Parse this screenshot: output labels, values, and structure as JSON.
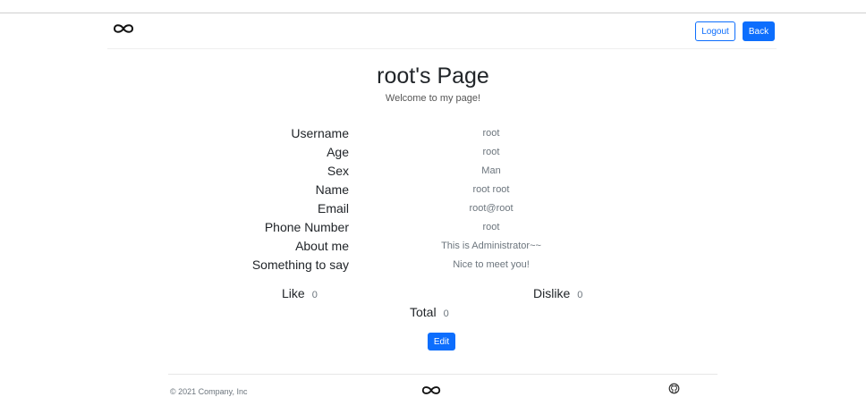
{
  "header": {
    "logo_icon": "infinity-icon",
    "logout_label": "Logout",
    "back_label": "Back"
  },
  "page": {
    "title": "root's Page",
    "subtitle": "Welcome to my page!"
  },
  "profile": [
    {
      "label": "Username",
      "value": "root"
    },
    {
      "label": "Age",
      "value": "root"
    },
    {
      "label": "Sex",
      "value": "Man"
    },
    {
      "label": "Name",
      "value": "root root"
    },
    {
      "label": "Email",
      "value": "root@root"
    },
    {
      "label": "Phone Number",
      "value": "root"
    },
    {
      "label": "About me",
      "value": "This is Administrator~~"
    },
    {
      "label": "Something to say",
      "value": "Nice to meet you!"
    }
  ],
  "stats": {
    "like_label": "Like",
    "like_value": "0",
    "dislike_label": "Dislike",
    "dislike_value": "0",
    "total_label": "Total",
    "total_value": "0"
  },
  "actions": {
    "edit_label": "Edit"
  },
  "footer": {
    "copyright": "© 2021 Company, Inc",
    "logo_icon": "infinity-icon",
    "github_icon": "github-icon"
  },
  "colors": {
    "primary": "#0d6efd",
    "muted": "#6c757d"
  }
}
